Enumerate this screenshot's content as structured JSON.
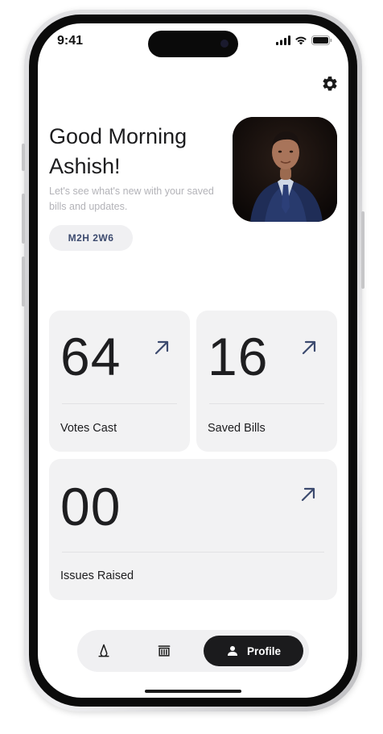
{
  "status_bar": {
    "time": "9:41"
  },
  "header": {
    "greeting": "Good Morning Ashish!",
    "subtext": "Let's see what's new with your saved bills and updates.",
    "postal_code": "M2H 2W6"
  },
  "stats": [
    {
      "value": "64",
      "label": "Votes Cast"
    },
    {
      "value": "16",
      "label": "Saved Bills"
    },
    {
      "value": "00",
      "label": "Issues Raised"
    }
  ],
  "nav": {
    "items": [
      "home-icon",
      "bills-icon",
      "profile-icon"
    ],
    "active_label": "Profile"
  },
  "colors": {
    "card_bg": "#f2f2f3",
    "arrow": "#3c4a6e",
    "chip_text": "#3c4a6e",
    "nav_active_bg": "#1b1b1d"
  }
}
